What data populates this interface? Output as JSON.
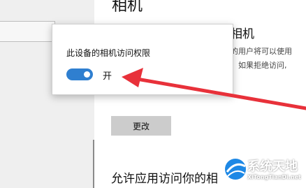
{
  "page": {
    "title": "相机"
  },
  "camera_section": {
    "title": "相机",
    "description_line1": "的用户将可以使用",
    "description_line2": "。如果拒绝访问,",
    "change_button_label": "更改"
  },
  "apps_section": {
    "title": "允许应用访问你的相"
  },
  "popup": {
    "label": "此设备的相机访问权限",
    "toggle_state": "开",
    "toggle_on": true,
    "toggle_color": "#2f7fd0"
  },
  "annotation": {
    "arrow_color": "#e8313a"
  },
  "watermark": {
    "name": "系统天地",
    "url": "XiTongTianDi.net",
    "brand_color": "#1e88e5"
  }
}
